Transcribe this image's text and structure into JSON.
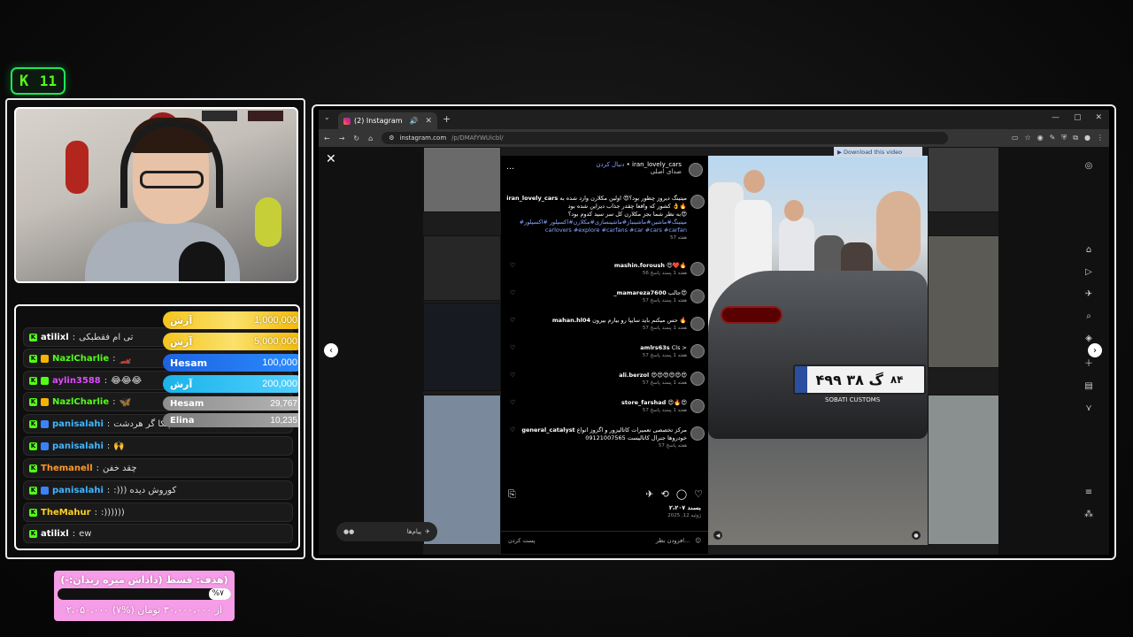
{
  "kick": {
    "logo": "K",
    "count": "11"
  },
  "chat": {
    "rows": [
      {
        "user": "atilixl",
        "msg": "تی ام فقطبکی",
        "color": "#ffffff"
      },
      {
        "user": "NazlCharlie",
        "msg": "",
        "color": "#53fc18"
      },
      {
        "user": "aylin3588",
        "msg": "😂😂😂",
        "color": "#e04aff"
      },
      {
        "user": "NazlCharlie",
        "msg": "",
        "color": "#53fc18"
      },
      {
        "user": "panisalahi",
        "msg": "همه پنکا گر هردشت",
        "color": "#3fb7ff"
      },
      {
        "user": "panisalahi",
        "msg": "🙌",
        "color": "#3fb7ff"
      },
      {
        "user": "Themanell",
        "msg": "چقد خفن",
        "color": "#ff9a2a"
      },
      {
        "user": "panisalahi",
        "msg": ":))) کوروش دیده",
        "color": "#3fb7ff"
      },
      {
        "user": "TheMahur",
        "msg": ":))))))",
        "color": "#ffd21f"
      },
      {
        "user": "atilixl",
        "msg": "ew",
        "color": "#ffffff"
      }
    ]
  },
  "donations": [
    {
      "name": "آرش",
      "amount": "1,000,000",
      "style": "gold"
    },
    {
      "name": "آرش",
      "amount": "5,000,000",
      "style": "gold"
    },
    {
      "name": "Hesam",
      "amount": "100,000",
      "style": "blue"
    },
    {
      "name": "آرش",
      "amount": "200,000",
      "style": "cyan"
    },
    {
      "name": "Hesam",
      "amount": "29,767",
      "style": "gray"
    },
    {
      "name": "Elina",
      "amount": "10,235",
      "style": "gray2"
    }
  ],
  "goal": {
    "title": "هدف: قسط (داداش میره زندان:-))",
    "percent_label": "%۷",
    "progress": 0.07,
    "subtitle": "۲،۰۵۰،۰۰۰ از ۳۰،۰۰۰،۰۰۰ تومان (%۷)"
  },
  "browser": {
    "tab_title": "(2) Instagram",
    "url_host": "instagram.com",
    "url_path": "/p/DMAfYWUicbl/",
    "download_label": "Download this video"
  },
  "post": {
    "author": "iran_lovely_cars",
    "follow": "دنبال کردن",
    "audio": "صدای اصلی",
    "caption_user": "iran_lovely_cars",
    "caption": "میتینگ دیروز چطور بود؟😍 اولین مکلارن وارد شده به کشور که واقعا چقدر جذاب دیزاین شده بود 👌🔥",
    "caption2": "به نظر شما بجز مکلارن کل سر سید کدوم بود؟😍",
    "hashtags": "#میتینگ#ماشین#ماشینباز#ماشینسازی#مکلارن#اکسپلور #اکسپلور carlovers #explore #carfans #car #cars #carfan",
    "caption_time": "57 هفته",
    "comments": [
      {
        "user": "mashin.foroush",
        "text": "😍❤️🔥",
        "meta": "56 هفته   1 پسند   پاسخ"
      },
      {
        "user": "_mamareza7600",
        "text": "جالب😍",
        "meta": "57 هفته   1 پسند   پاسخ"
      },
      {
        "user": "mahan.hl04",
        "text": "حس میکنم باید سایپا رو بیارم بیرون 🔥",
        "meta": "57 هفته   1 پسند   پاسخ"
      },
      {
        "user": "amlrs63s",
        "text": "Cls >",
        "meta": "57 هفته   1 پسند   پاسخ"
      },
      {
        "user": "ali.berzol",
        "text": "😍😍😍😍😍😍",
        "meta": "57 هفته   1 پسند   پاسخ"
      },
      {
        "user": "store_farshad",
        "text": "😍🔥😍",
        "meta": "57 هفته   1 پسند   پاسخ"
      },
      {
        "user": "general_catalyst",
        "text": "مرکز تخصصی تعمیرات کاتالیزور و اگزوز انواع خودروها جنرال کاتالیست 09121007565",
        "meta": "57 هفته   پاسخ"
      }
    ],
    "likes": "۲،۲۰۷ پسند",
    "date": "ژوئیه 12, 2025",
    "add_comment": "افزودن نظر...",
    "post_btn": "پست کردن",
    "messages": "پیام‌ها"
  },
  "plate": {
    "text": "۴۹۹ گ ۳۸",
    "region": "۸۴",
    "sub": "SOBATI CUSTOMS"
  }
}
